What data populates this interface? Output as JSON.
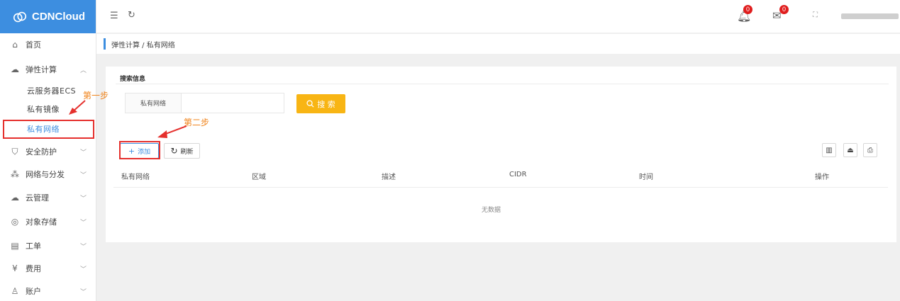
{
  "app": {
    "name": "CDNCloud"
  },
  "sidebar": {
    "items": [
      {
        "label": "首页",
        "icon": "home-icon"
      },
      {
        "label": "弹性计算",
        "icon": "cloud-compute-icon",
        "expanded": true,
        "children": [
          "云服务器ECS",
          "私有镜像",
          "私有网络"
        ]
      },
      {
        "label": "安全防护",
        "icon": "shield-icon"
      },
      {
        "label": "网络与分发",
        "icon": "network-icon"
      },
      {
        "label": "云管理",
        "icon": "cloud-manage-icon"
      },
      {
        "label": "对象存储",
        "icon": "storage-icon"
      },
      {
        "label": "工单",
        "icon": "ticket-icon"
      },
      {
        "label": "费用",
        "icon": "yen-icon"
      },
      {
        "label": "账户",
        "icon": "user-icon"
      }
    ],
    "active_child": "私有网络"
  },
  "topbar": {
    "notifications_count": "0",
    "messages_count": "0"
  },
  "breadcrumb": {
    "text": "弹性计算 / 私有网络"
  },
  "search": {
    "section_title": "搜索信息",
    "field_label": "私有网络",
    "field_value": "",
    "button_label": "搜 索"
  },
  "actions": {
    "add_label": "添加",
    "refresh_label": "刷新"
  },
  "table": {
    "headers": [
      "私有网络",
      "区域",
      "描述",
      "CIDR",
      "时间",
      "操作"
    ],
    "empty_text": "无数据"
  },
  "annotations": {
    "step1": "第一步",
    "step2": "第二步"
  },
  "colors": {
    "brand": "#3d8ee0",
    "search_button": "#f8b514",
    "highlight": "#e5302d",
    "annotation": "#f0831a",
    "badge": "#e01e1e"
  }
}
